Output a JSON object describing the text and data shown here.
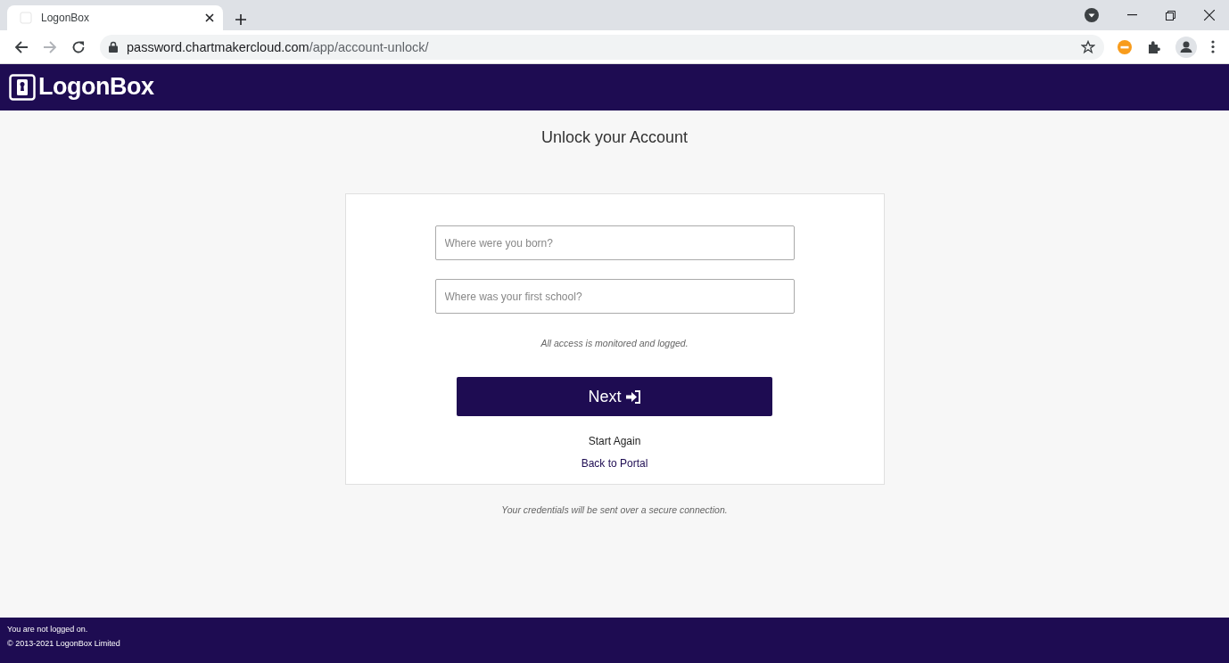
{
  "browser": {
    "tab": {
      "title": "LogonBox",
      "selected": true
    },
    "address_bar": {
      "host": "password.chartmakercloud.com",
      "path": "/app/account-unlock/"
    }
  },
  "header": {
    "logo_text": "LogonBox"
  },
  "page": {
    "title": "Unlock your Account",
    "fields": [
      {
        "placeholder": "Where were you born?"
      },
      {
        "placeholder": "Where was your first school?"
      }
    ],
    "notice": "All access is monitored and logged.",
    "button": "Next",
    "links": [
      "Start Again",
      "Back to Portal"
    ],
    "secure_note": "Your credentials will be sent over a secure connection."
  },
  "footer": {
    "status": "You are not logged on.",
    "copyright": "© 2013-2021 LogonBox Limited"
  }
}
